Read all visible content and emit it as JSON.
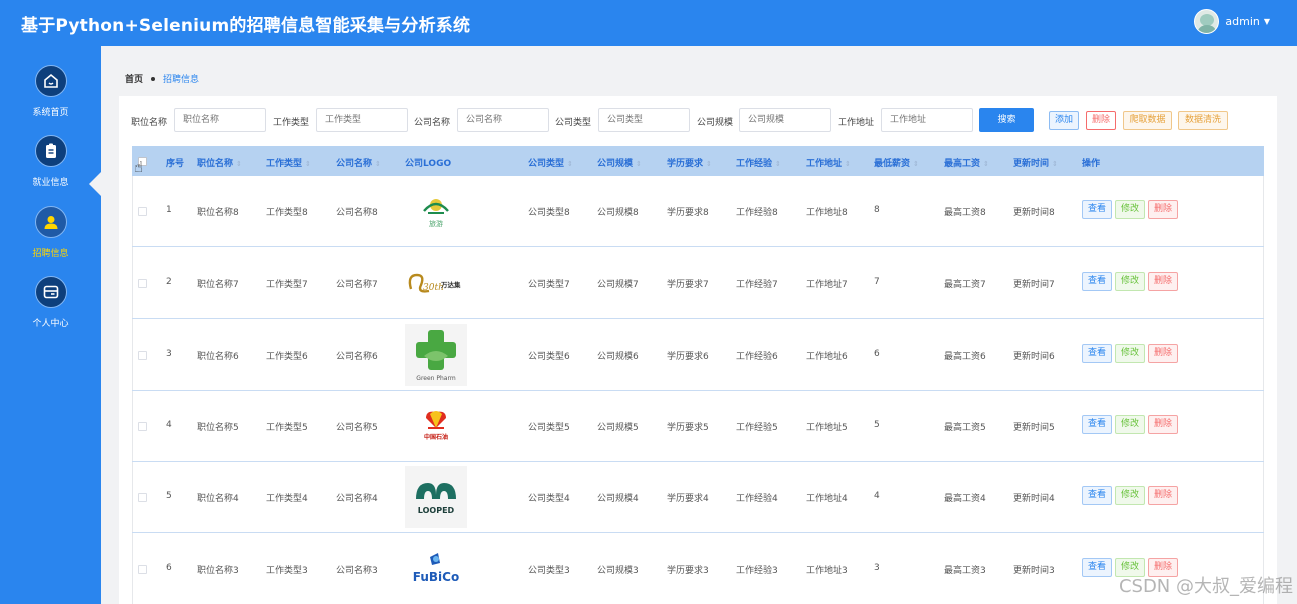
{
  "header": {
    "title": "基于Python+Selenium的招聘信息智能采集与分析系统",
    "user": "admin",
    "caret": "▼"
  },
  "sidebar": {
    "items": [
      {
        "label": "系统首页",
        "icon": "home-icon"
      },
      {
        "label": "就业信息",
        "icon": "document-icon"
      },
      {
        "label": "招聘信息",
        "icon": "user-icon",
        "active": true
      },
      {
        "label": "个人中心",
        "icon": "profile-card-icon"
      }
    ]
  },
  "breadcrumb": {
    "home": "首页",
    "current": "招聘信息"
  },
  "search": {
    "fields": [
      {
        "label": "职位名称",
        "placeholder": "职位名称"
      },
      {
        "label": "工作类型",
        "placeholder": "工作类型"
      },
      {
        "label": "公司名称",
        "placeholder": "公司名称"
      },
      {
        "label": "公司类型",
        "placeholder": "公司类型"
      },
      {
        "label": "公司规模",
        "placeholder": "公司规模"
      },
      {
        "label": "工作地址",
        "placeholder": "工作地址"
      }
    ],
    "search_button": "搜索",
    "add_button": "添加",
    "delete_button": "删除",
    "crawl_button": "爬取数据",
    "clean_button": "数据清洗"
  },
  "table": {
    "columns": [
      "序号",
      "职位名称",
      "工作类型",
      "公司名称",
      "公司LOGO",
      "公司类型",
      "公司规模",
      "学历要求",
      "工作经验",
      "工作地址",
      "最低薪资",
      "最高工资",
      "更新时间",
      "操作"
    ],
    "sort_glyph": "⇕",
    "actions": {
      "view": "查看",
      "edit": "修改",
      "delete": "删除"
    },
    "rows": [
      {
        "index": "1",
        "job": "职位名称8",
        "type": "工作类型8",
        "company": "公司名称8",
        "logo_text": "旅游",
        "ctype": "公司类型8",
        "scale": "公司规模8",
        "edu": "学历要求8",
        "exp": "工作经验8",
        "addr": "工作地址8",
        "min": "8",
        "max": "最高工资8",
        "updated": "更新时间8"
      },
      {
        "index": "2",
        "job": "职位名称7",
        "type": "工作类型7",
        "company": "公司名称7",
        "logo_text": "万达集",
        "logo_sub": "30th",
        "ctype": "公司类型7",
        "scale": "公司规模7",
        "edu": "学历要求7",
        "exp": "工作经验7",
        "addr": "工作地址7",
        "min": "7",
        "max": "最高工资7",
        "updated": "更新时间7"
      },
      {
        "index": "3",
        "job": "职位名称6",
        "type": "工作类型6",
        "company": "公司名称6",
        "logo_text": "Green Pharm",
        "ctype": "公司类型6",
        "scale": "公司规模6",
        "edu": "学历要求6",
        "exp": "工作经验6",
        "addr": "工作地址6",
        "min": "6",
        "max": "最高工资6",
        "updated": "更新时间6"
      },
      {
        "index": "4",
        "job": "职位名称5",
        "type": "工作类型5",
        "company": "公司名称5",
        "logo_text": "中国石油",
        "ctype": "公司类型5",
        "scale": "公司规模5",
        "edu": "学历要求5",
        "exp": "工作经验5",
        "addr": "工作地址5",
        "min": "5",
        "max": "最高工资5",
        "updated": "更新时间5"
      },
      {
        "index": "5",
        "job": "职位名称4",
        "type": "工作类型4",
        "company": "公司名称4",
        "logo_text": "LOOPED",
        "ctype": "公司类型4",
        "scale": "公司规模4",
        "edu": "学历要求4",
        "exp": "工作经验4",
        "addr": "工作地址4",
        "min": "4",
        "max": "最高工资4",
        "updated": "更新时间4"
      },
      {
        "index": "6",
        "job": "职位名称3",
        "type": "工作类型3",
        "company": "公司名称3",
        "logo_text": "FuBiCo",
        "ctype": "公司类型3",
        "scale": "公司规模3",
        "edu": "学历要求3",
        "exp": "工作经验3",
        "addr": "工作地址3",
        "min": "3",
        "max": "最高工资3",
        "updated": "更新时间3"
      }
    ]
  },
  "watermark": "CSDN @大叔_爱编程"
}
